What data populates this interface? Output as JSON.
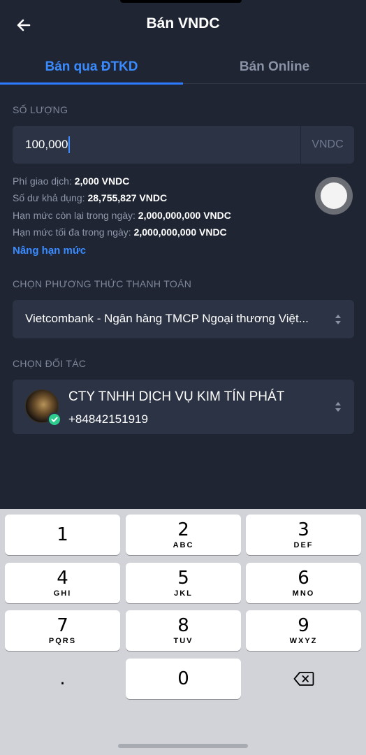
{
  "header": {
    "title": "Bán VNDC",
    "back_icon": "arrow-left-icon"
  },
  "tabs": [
    {
      "label": "Bán qua ĐTKD",
      "active": true
    },
    {
      "label": "Bán Online",
      "active": false
    }
  ],
  "amount": {
    "label": "SỐ LƯỢNG",
    "value": "100,000",
    "unit": "VNDC"
  },
  "info": {
    "fee_label": "Phí giao dịch:",
    "fee_value": "2,000 VNDC",
    "balance_label": "Số dư khả dụng:",
    "balance_value": "28,755,827 VNDC",
    "remaining_label": "Hạn mức còn lại trong ngày:",
    "remaining_value": "2,000,000,000 VNDC",
    "max_label": "Hạn mức tối đa trong ngày:",
    "max_value": "2,000,000,000 VNDC",
    "upgrade_link": "Nâng hạn mức"
  },
  "payment": {
    "label": "CHỌN PHƯƠNG THỨC THANH TOÁN",
    "selected": "Vietcombank - Ngân hàng TMCP Ngoại thương Việt..."
  },
  "partner": {
    "label": "CHỌN ĐỐI TÁC",
    "name": "CTY TNHH DỊCH VỤ KIM TÍN PHÁT",
    "phone": "+84842151919",
    "verified_icon": "check-circle-icon"
  },
  "keyboard": {
    "keys": [
      {
        "num": "1",
        "letters": ""
      },
      {
        "num": "2",
        "letters": "ABC"
      },
      {
        "num": "3",
        "letters": "DEF"
      },
      {
        "num": "4",
        "letters": "GHI"
      },
      {
        "num": "5",
        "letters": "JKL"
      },
      {
        "num": "6",
        "letters": "MNO"
      },
      {
        "num": "7",
        "letters": "PQRS"
      },
      {
        "num": "8",
        "letters": "TUV"
      },
      {
        "num": "9",
        "letters": "WXYZ"
      },
      {
        "num": ".",
        "letters": ""
      },
      {
        "num": "0",
        "letters": ""
      }
    ],
    "delete_icon": "backspace-icon"
  },
  "colors": {
    "background": "#1f2532",
    "accent": "#3a8bff",
    "field": "#2b3345",
    "verified": "#2ecc8f"
  }
}
